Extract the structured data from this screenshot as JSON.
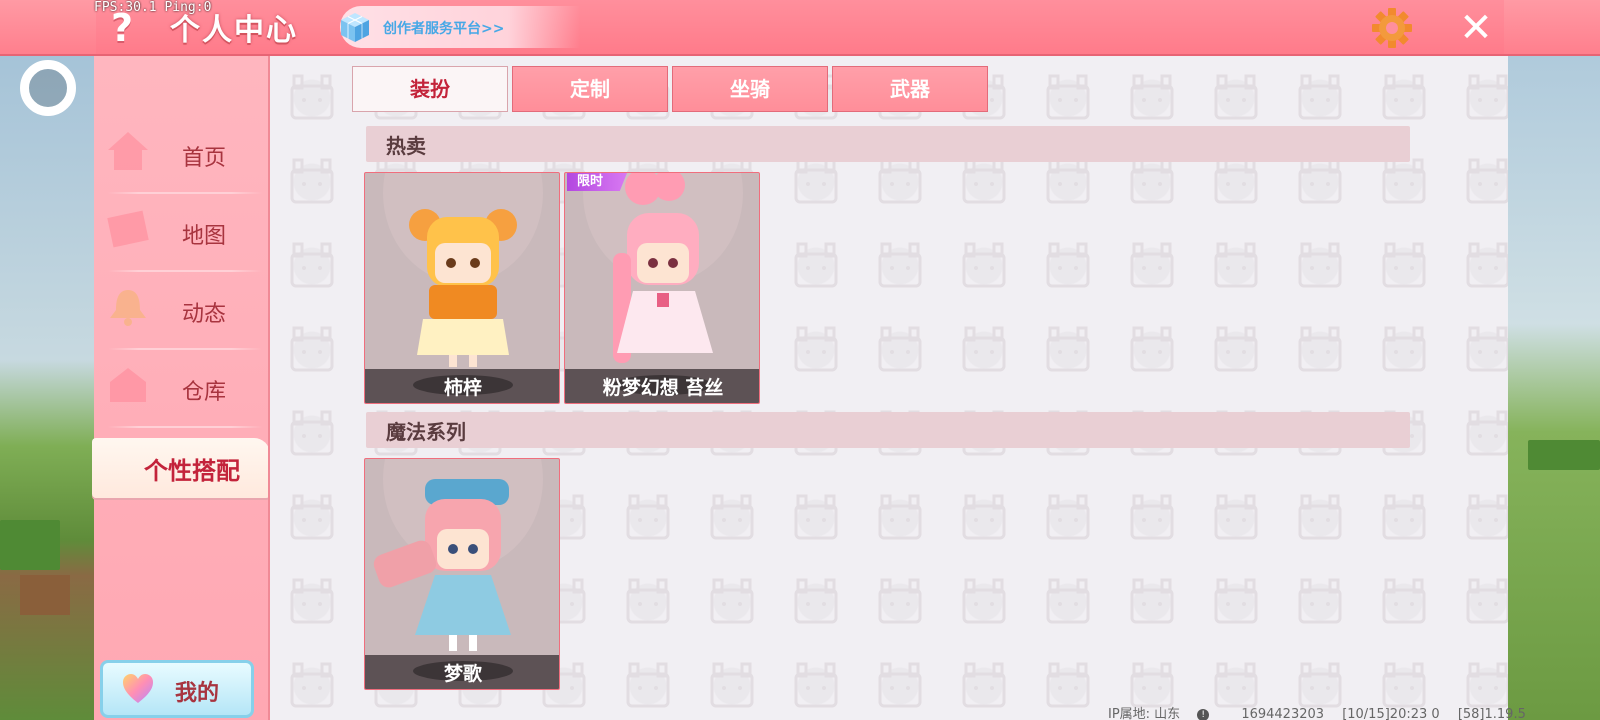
{
  "overlay": {
    "fps": "FPS:30.1  Ping:0"
  },
  "header": {
    "help_icon": "question-mark-icon",
    "title": "个人中心",
    "creator_link": "创作者服务平台>>",
    "settings_icon": "gear-icon",
    "close_icon": "close-icon",
    "accent_color": "#ff7f8d"
  },
  "sidebar": {
    "items": [
      {
        "label": "首页",
        "icon": "home-icon"
      },
      {
        "label": "地图",
        "icon": "map-icon"
      },
      {
        "label": "动态",
        "icon": "bell-icon"
      },
      {
        "label": "仓库",
        "icon": "warehouse-icon"
      },
      {
        "label": "个性搭配",
        "icon": "",
        "active": true
      }
    ],
    "mine_button": {
      "label": "我的",
      "icon": "heart-icon"
    }
  },
  "tabs": [
    {
      "label": "装扮",
      "active": true
    },
    {
      "label": "定制",
      "active": false
    },
    {
      "label": "坐骑",
      "active": false
    },
    {
      "label": "武器",
      "active": false
    }
  ],
  "sections": [
    {
      "title": "热卖",
      "items": [
        {
          "name": "柿梓",
          "badge": ""
        },
        {
          "name": "粉梦幻想 苔丝",
          "badge": "限时"
        }
      ]
    },
    {
      "title": "魔法系列",
      "items": [
        {
          "name": "梦歌",
          "badge": ""
        }
      ]
    }
  ],
  "footer": {
    "ip_location": "IP属地: 山东",
    "uid": "1694423203",
    "timestamp": "[10/15]20:23 0",
    "version": "[58]1.19.5"
  }
}
